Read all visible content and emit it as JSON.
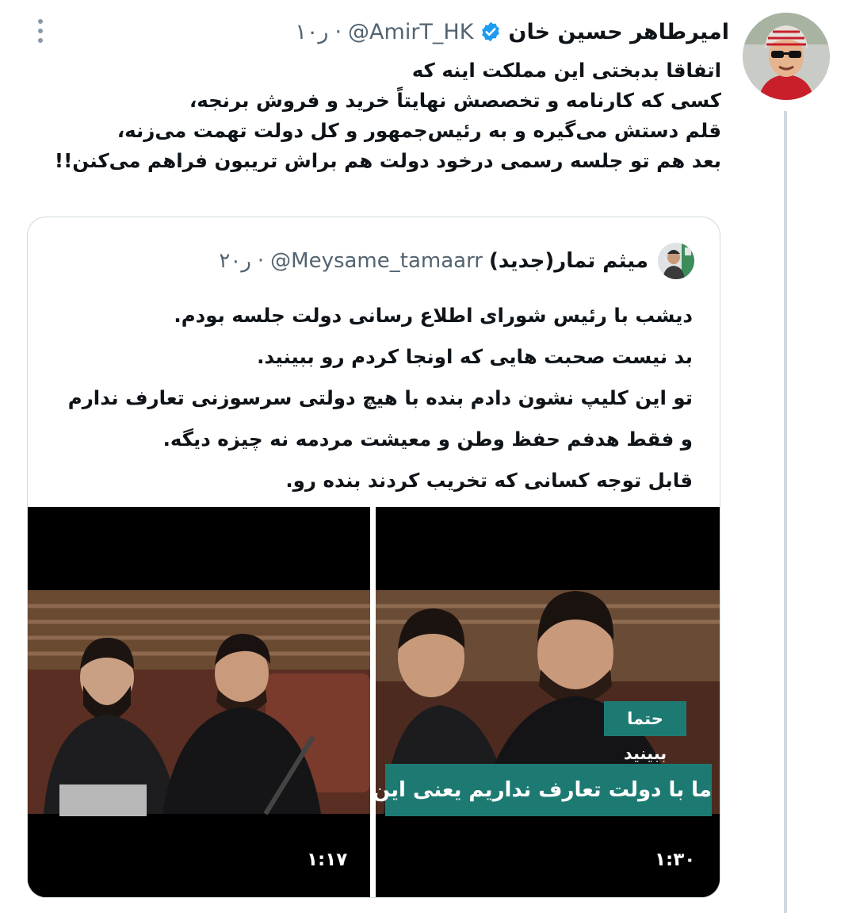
{
  "tweet": {
    "author_name": "امیرطاهر حسین خان",
    "handle": "@AmirT_HK",
    "separator": "·",
    "time": "۱۰ر",
    "text": "اتفاقا بدبختی این مملکت اینه که\nکسی که کارنامه و تخصصش نهایتاً خرید و فروش برنجه،\nقلم دستش می‌گیره و به رئیس‌جمهور و کل دولت تهمت می‌زنه،\nبعد هم تو جلسه رسمی درخود دولت هم براش تریبون فراهم می‌کنن!!"
  },
  "quote": {
    "author_name": "میثم تمار(جدید)",
    "handle": "@Meysame_tamaarr",
    "separator": "·",
    "time": "۲۰ر",
    "text": "دیشب با رئیس شورای اطلاع رسانی دولت جلسه بودم.\nبد نیست صحبت هایی که اونجا کردم رو ببینید.\nتو این کلیپ نشون دادم بنده با هیچ دولتی سرسوزنی تعارف ندارم\nو فقط هدفم حفظ وطن و معیشت مردمه نه چیزه دیگه.\nقابل توجه کسانی که تخریب کردند بنده رو.",
    "videos": [
      {
        "duration": "۱:۱۷"
      },
      {
        "duration": "۱:۳۰",
        "caption_top": "حتما ببینید",
        "caption_main": "ما با دولت تعارف نداریم یعنی این کلیپ"
      }
    ]
  },
  "colors": {
    "verified": "#1d9bf0",
    "caption_bg": "#1d7a73",
    "muted": "#536471",
    "border": "#cfd9de"
  },
  "icons": [
    "more-vertical-icon",
    "verified-badge-icon"
  ]
}
